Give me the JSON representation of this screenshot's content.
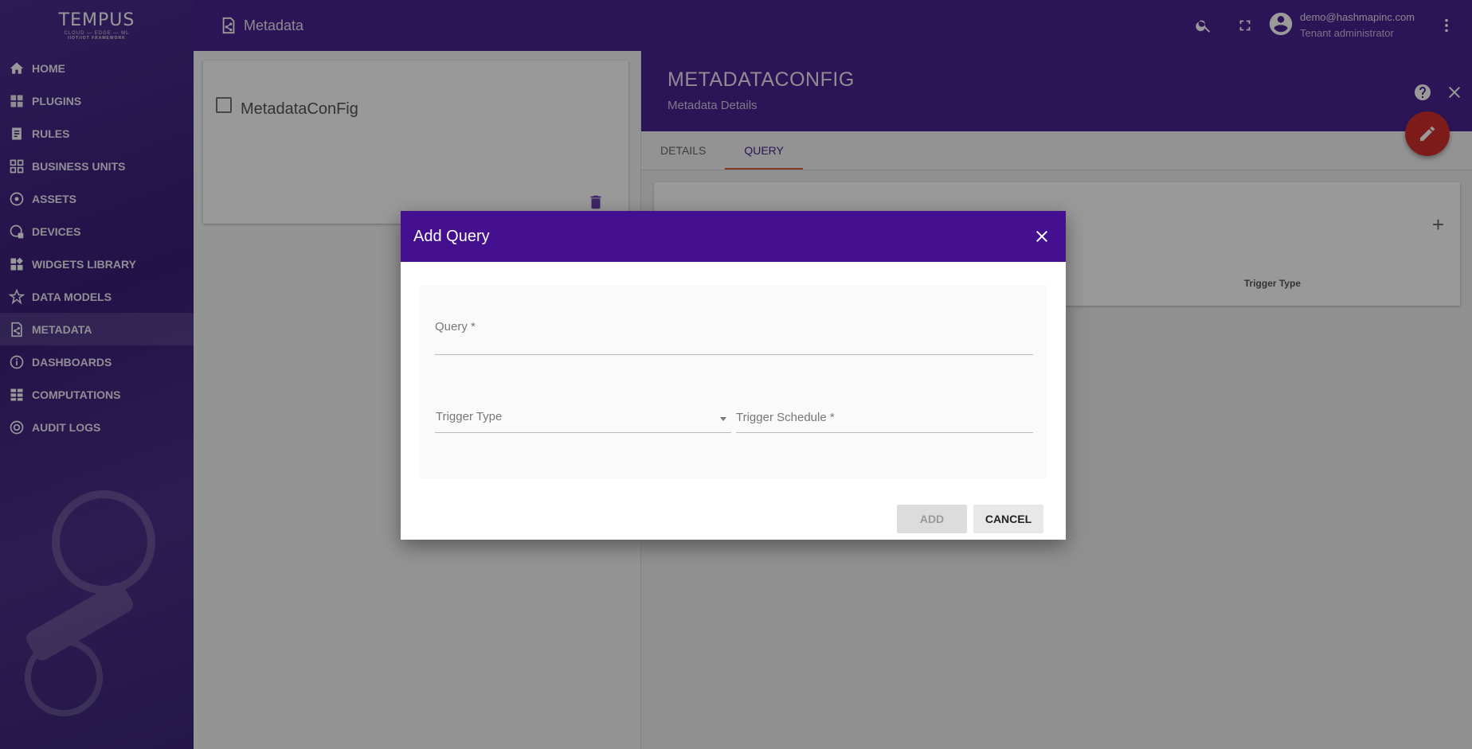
{
  "sidebar": {
    "logo": {
      "brand": "TEMPUS",
      "tagline": "CLOUD — EDGE — ML",
      "subtagline": "IIOT/IOT FRAMEWORK"
    },
    "items": [
      {
        "label": "HOME",
        "icon": "home-icon"
      },
      {
        "label": "PLUGINS",
        "icon": "plugin-icon"
      },
      {
        "label": "RULES",
        "icon": "rules-icon"
      },
      {
        "label": "BUSINESS UNITS",
        "icon": "business-units-icon"
      },
      {
        "label": "ASSETS",
        "icon": "assets-icon"
      },
      {
        "label": "DEVICES",
        "icon": "devices-icon"
      },
      {
        "label": "WIDGETS LIBRARY",
        "icon": "widgets-icon"
      },
      {
        "label": "DATA MODELS",
        "icon": "data-models-icon"
      },
      {
        "label": "METADATA",
        "icon": "metadata-icon",
        "active": true
      },
      {
        "label": "DASHBOARDS",
        "icon": "dashboards-icon"
      },
      {
        "label": "COMPUTATIONS",
        "icon": "computations-icon"
      },
      {
        "label": "AUDIT LOGS",
        "icon": "audit-logs-icon"
      }
    ]
  },
  "topbar": {
    "breadcrumb": "Metadata",
    "user_email": "demo@hashmapinc.com",
    "user_role": "Tenant administrator"
  },
  "list": {
    "card_title": "MetadataConFig"
  },
  "details": {
    "title": "METADATACONFIG",
    "subtitle": "Metadata Details",
    "tabs": [
      "DETAILS",
      "QUERY"
    ],
    "active_tab": "QUERY",
    "table_column": "Trigger Type",
    "add_symbol": "+"
  },
  "dialog": {
    "title": "Add Query",
    "query_label": "Query *",
    "trigger_type_label": "Trigger Type",
    "trigger_schedule_label": "Trigger Schedule *",
    "add_label": "ADD",
    "cancel_label": "CANCEL"
  },
  "colors": {
    "primary": "#4a238f",
    "dialog_header": "#44108f",
    "fab": "#d32f2f",
    "tab_indicator": "#d65a2c"
  }
}
